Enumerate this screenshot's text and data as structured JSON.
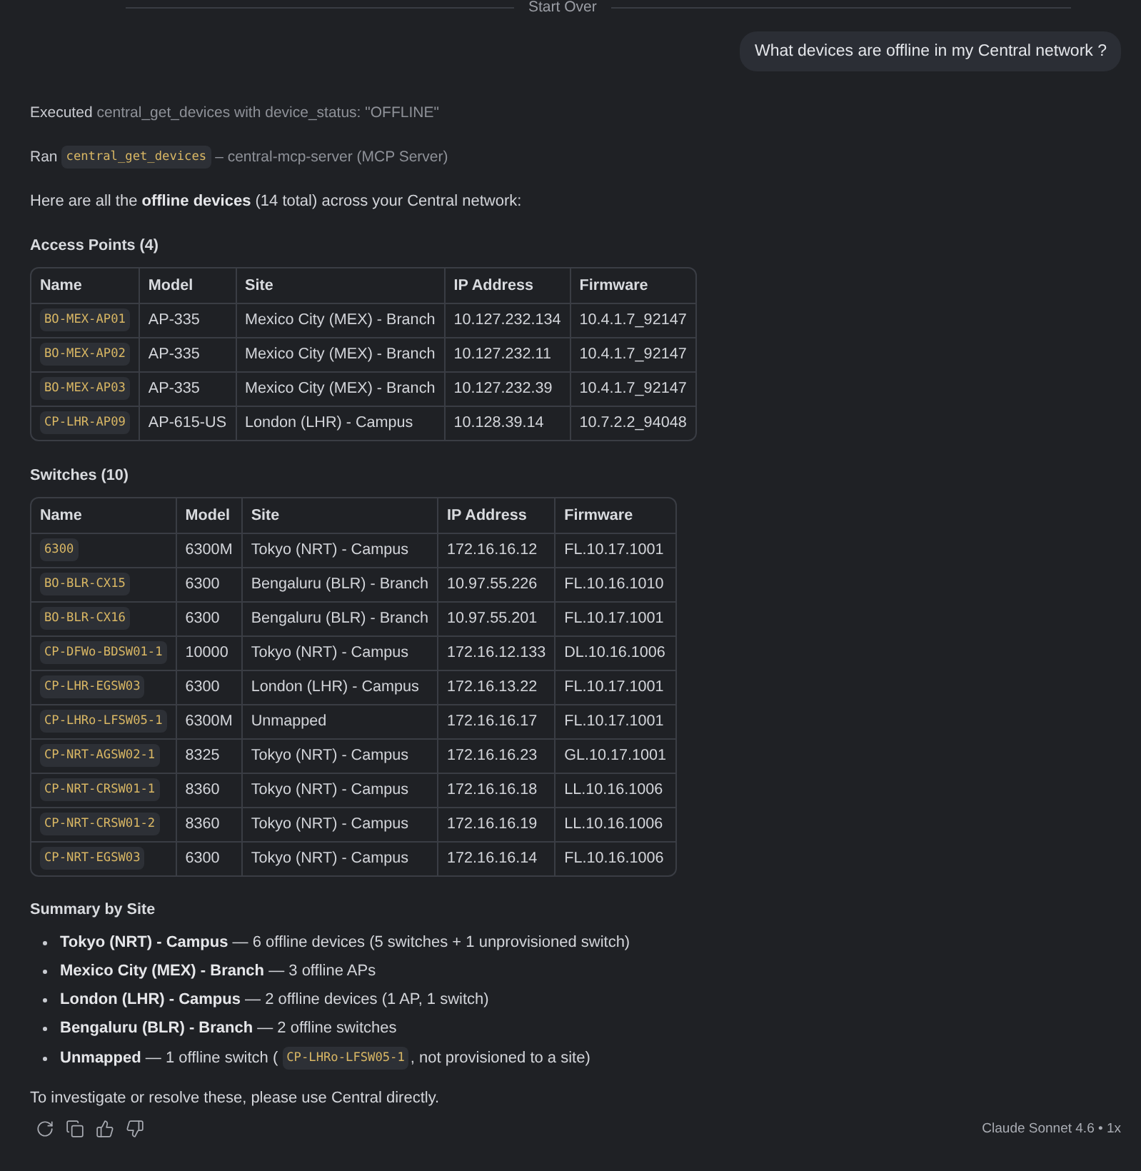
{
  "divider": {
    "label": "Start Over"
  },
  "user_message": {
    "text": "What devices are offline in my Central network ?"
  },
  "tool_calls": [
    {
      "kind": "executed",
      "label": "Executed",
      "detail": "central_get_devices with device_status: \"OFFLINE\""
    },
    {
      "kind": "ran",
      "label": "Ran",
      "code": "central_get_devices",
      "detail": "– central-mcp-server (MCP Server)"
    }
  ],
  "intro": "Here are all the **offline devices** (14 total) across your Central network:",
  "sections": [
    {
      "title": "Access Points (4)",
      "columns": [
        {
          "label": "Name",
          "kind": "code"
        },
        {
          "label": "Model",
          "kind": "text"
        },
        {
          "label": "Site",
          "kind": "text"
        },
        {
          "label": "IP Address",
          "kind": "text"
        },
        {
          "label": "Firmware",
          "kind": "text"
        }
      ],
      "rows": [
        [
          "BO-MEX-AP01",
          "AP-335",
          "Mexico City (MEX) - Branch",
          "10.127.232.134",
          "10.4.1.7_92147"
        ],
        [
          "BO-MEX-AP02",
          "AP-335",
          "Mexico City (MEX) - Branch",
          "10.127.232.11",
          "10.4.1.7_92147"
        ],
        [
          "BO-MEX-AP03",
          "AP-335",
          "Mexico City (MEX) - Branch",
          "10.127.232.39",
          "10.4.1.7_92147"
        ],
        [
          "CP-LHR-AP09",
          "AP-615-US",
          "London (LHR) - Campus",
          "10.128.39.14",
          "10.7.2.2_94048"
        ]
      ]
    },
    {
      "title": "Switches (10)",
      "columns": [
        {
          "label": "Name",
          "kind": "code"
        },
        {
          "label": "Model",
          "kind": "text"
        },
        {
          "label": "Site",
          "kind": "text"
        },
        {
          "label": "IP Address",
          "kind": "text"
        },
        {
          "label": "Firmware",
          "kind": "text"
        }
      ],
      "rows": [
        [
          "6300",
          "6300M",
          "Tokyo (NRT) - Campus",
          "172.16.16.12",
          "FL.10.17.1001"
        ],
        [
          "BO-BLR-CX15",
          "6300",
          "Bengaluru (BLR) - Branch",
          "10.97.55.226",
          "FL.10.16.1010"
        ],
        [
          "BO-BLR-CX16",
          "6300",
          "Bengaluru (BLR) - Branch",
          "10.97.55.201",
          "FL.10.17.1001"
        ],
        [
          "CP-DFWo-BDSW01-1",
          "10000",
          "Tokyo (NRT) - Campus",
          "172.16.12.133",
          "DL.10.16.1006"
        ],
        [
          "CP-LHR-EGSW03",
          "6300",
          "London (LHR) - Campus",
          "172.16.13.22",
          "FL.10.17.1001"
        ],
        [
          "CP-LHRo-LFSW05-1",
          "6300M",
          "Unmapped",
          "172.16.16.17",
          "FL.10.17.1001"
        ],
        [
          "CP-NRT-AGSW02-1",
          "8325",
          "Tokyo (NRT) - Campus",
          "172.16.16.23",
          "GL.10.17.1001"
        ],
        [
          "CP-NRT-CRSW01-1",
          "8360",
          "Tokyo (NRT) - Campus",
          "172.16.16.18",
          "LL.10.16.1006"
        ],
        [
          "CP-NRT-CRSW01-2",
          "8360",
          "Tokyo (NRT) - Campus",
          "172.16.16.19",
          "LL.10.16.1006"
        ],
        [
          "CP-NRT-EGSW03",
          "6300",
          "Tokyo (NRT) - Campus",
          "172.16.16.14",
          "FL.10.16.1006"
        ]
      ]
    }
  ],
  "summary": {
    "title": "Summary by Site",
    "items": [
      {
        "text": "**Tokyo (NRT) - Campus** — 6 offline devices (5 switches + 1 unprovisioned switch)"
      },
      {
        "text": "**Mexico City (MEX) - Branch** — 3 offline APs"
      },
      {
        "text": "**London (LHR) - Campus** — 2 offline devices (1 AP, 1 switch)"
      },
      {
        "text": "**Bengaluru (BLR) - Branch** — 2 offline switches"
      },
      {
        "text": "**Unmapped** — 1 offline switch (",
        "code": "CP-LHRo-LFSW05-1",
        "text_after": ", not provisioned to a site)"
      }
    ]
  },
  "closing": "To investigate or resolve these, please use Central directly.",
  "actions": [
    {
      "kind": "retry"
    },
    {
      "kind": "copy"
    },
    {
      "kind": "thumbs_up"
    },
    {
      "kind": "thumbs_down"
    }
  ],
  "model_label": "Claude Sonnet 4.6 • 1x"
}
